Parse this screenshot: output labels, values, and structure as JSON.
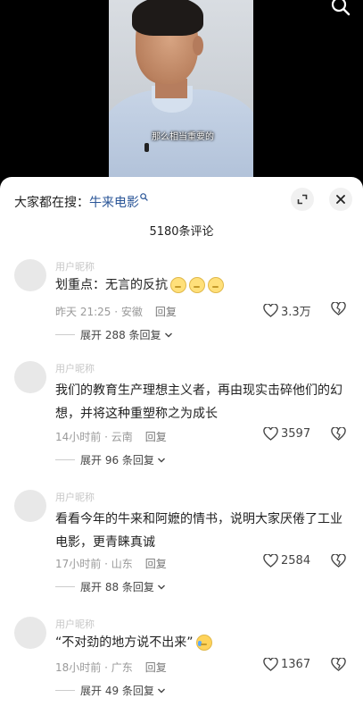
{
  "video": {
    "subtitle": "那么相当重要的"
  },
  "header": {
    "search_prefix": "大家都在搜：",
    "search_keyword": "牛来电影"
  },
  "comment_count": "5180条评论",
  "comments": [
    {
      "text": "划重点：无言的反抗",
      "time": "昨天 21:25 · 安徽",
      "reply": "回复",
      "likes": "3.3万",
      "expand": "展开 288 条回复",
      "emoji": [
        "neutral",
        "neutral",
        "neutral"
      ]
    },
    {
      "text": "我们的教育生产理想主义者，再由现实击碎他们的幻想，并将这种重塑称之为成长",
      "time": "14小时前 · 云南",
      "reply": "回复",
      "likes": "3597",
      "expand": "展开 96 条回复"
    },
    {
      "text": "看看今年的牛来和阿嬷的情书，说明大家厌倦了工业电影，更青睐真诚",
      "time": "17小时前 · 山东",
      "reply": "回复",
      "likes": "2584",
      "expand": "展开 88 条回复"
    },
    {
      "text": "“不对劲的地方说不出来”",
      "time": "18小时前 · 广东",
      "reply": "回复",
      "likes": "1367",
      "expand": "展开 49 条回复",
      "emoji": [
        "crying"
      ]
    }
  ],
  "icons": {
    "top": "search-icon",
    "expand_window": "expand-icon",
    "close": "close-icon",
    "like": "heart-icon",
    "dislike": "broken-heart-icon"
  }
}
